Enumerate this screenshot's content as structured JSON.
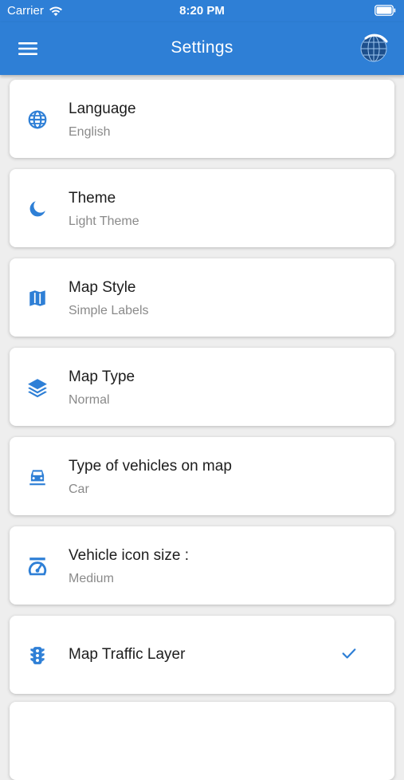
{
  "status_bar": {
    "carrier": "Carrier",
    "time": "8:20 PM"
  },
  "app_bar": {
    "title": "Settings"
  },
  "colors": {
    "primary": "#2e7fd6",
    "card": "#ffffff",
    "background": "#eeeeee"
  },
  "settings": [
    {
      "title": "Language",
      "value": "English",
      "icon": "globe-icon"
    },
    {
      "title": "Theme",
      "value": "Light Theme",
      "icon": "moon-icon"
    },
    {
      "title": "Map Style",
      "value": "Simple Labels",
      "icon": "map-icon"
    },
    {
      "title": "Map Type",
      "value": "Normal",
      "icon": "layers-icon"
    },
    {
      "title": "Type of vehicles on map",
      "value": "Car",
      "icon": "car-icon"
    },
    {
      "title": "Vehicle icon size :",
      "value": "Medium",
      "icon": "speedometer-icon"
    },
    {
      "title": "Map Traffic Layer",
      "icon": "traffic-light-icon",
      "checked": true
    }
  ]
}
